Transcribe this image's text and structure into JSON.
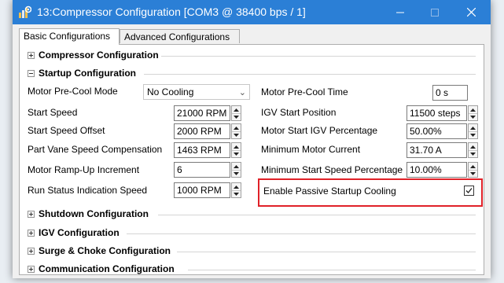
{
  "window": {
    "title": "13:Compressor Configuration [COM3 @ 38400 bps / 1]"
  },
  "tabs": [
    {
      "label": "Basic Configurations",
      "active": true
    },
    {
      "label": "Advanced Configurations",
      "active": false
    }
  ],
  "groups": {
    "compressor": {
      "title": "Compressor Configuration",
      "expanded": false
    },
    "startup": {
      "title": "Startup Configuration",
      "expanded": true
    },
    "shutdown": {
      "title": "Shutdown Configuration",
      "expanded": false
    },
    "igv": {
      "title": "IGV Configuration",
      "expanded": false
    },
    "surge": {
      "title": "Surge & Choke Configuration",
      "expanded": false
    },
    "communication": {
      "title": "Communication Configuration",
      "expanded": false
    }
  },
  "startup": {
    "motor_precool_mode": {
      "label": "Motor Pre-Cool Mode",
      "value": "No Cooling"
    },
    "start_speed": {
      "label": "Start Speed",
      "value": "21000 RPM"
    },
    "start_speed_offset": {
      "label": "Start Speed Offset",
      "value": "2000 RPM"
    },
    "part_vane_speed_comp": {
      "label": "Part Vane Speed Compensation",
      "value": "1463 RPM"
    },
    "motor_rampup_increment": {
      "label": "Motor Ramp-Up Increment",
      "value": "6"
    },
    "run_status_indication_speed": {
      "label": "Run Status Indication Speed",
      "value": "1000 RPM"
    },
    "motor_precool_time": {
      "label": "Motor Pre-Cool Time",
      "value": "0 s"
    },
    "igv_start_position": {
      "label": "IGV Start Position",
      "value": "11500 steps"
    },
    "motor_start_igv_percentage": {
      "label": "Motor Start IGV Percentage",
      "value": "50.00%"
    },
    "minimum_motor_current": {
      "label": "Minimum Motor Current",
      "value": "31.70 A"
    },
    "minimum_start_speed_percentage": {
      "label": "Minimum Start Speed Percentage",
      "value": "10.00%"
    },
    "enable_passive_startup_cooling": {
      "label": "Enable Passive Startup Cooling",
      "checked": true
    }
  },
  "colors": {
    "titlebar": "#2b7fd6",
    "highlight": "#e02128"
  },
  "icons": {
    "app": "gear-chart-icon",
    "minimize": "minimize-icon",
    "maximize": "maximize-icon",
    "close": "close-icon"
  }
}
